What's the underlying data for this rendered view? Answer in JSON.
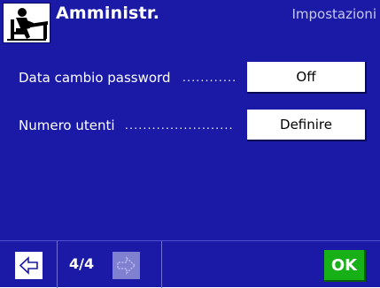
{
  "header": {
    "title": "Amministr.",
    "section": "Impostazioni",
    "icon": "admin-person-icon"
  },
  "settings": [
    {
      "label": "Data cambio password",
      "dots": "............",
      "value": "Off"
    },
    {
      "label": "Numero utenti",
      "dots": "........................",
      "value": "Definire"
    }
  ],
  "footer": {
    "page": "4/4",
    "prev_icon": "arrow-left-icon",
    "next_icon": "arrow-right-icon",
    "ok_label": "OK"
  },
  "colors": {
    "background": "#1a1aa6",
    "button": "#ffffff",
    "ok_button": "#17b017",
    "disabled_button": "#8080d0"
  }
}
